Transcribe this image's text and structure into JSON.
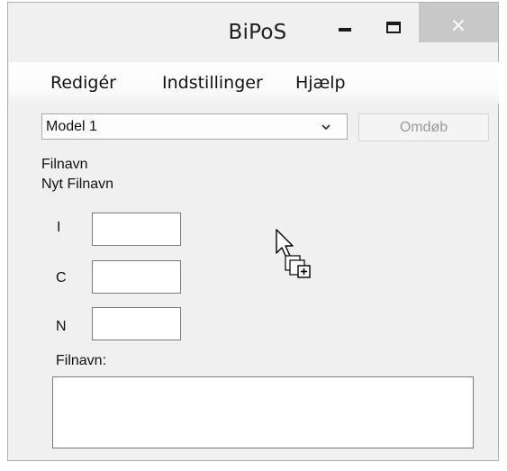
{
  "window": {
    "title": "BiPoS",
    "controls": {
      "minimize": "minimize-icon",
      "maximize": "maximize-icon",
      "close_symbol": "×"
    }
  },
  "menubar": {
    "items": [
      {
        "label": "Redigér"
      },
      {
        "label": "Indstillinger"
      },
      {
        "label": "Hjælp"
      }
    ]
  },
  "model_select": {
    "value": "Model 1",
    "icon": "chevron-down-icon"
  },
  "rename_button": {
    "label": "Omdøb",
    "state": "disabled"
  },
  "labels": {
    "filename": "Filnavn",
    "new_filename": "Nyt Filnavn"
  },
  "fields": [
    {
      "label": "I",
      "value": ""
    },
    {
      "label": "C",
      "value": ""
    },
    {
      "label": "N",
      "value": ""
    }
  ],
  "output": {
    "label": "Filnavn:",
    "value": ""
  },
  "cursor": {
    "icon": "copy-drag-cursor-icon"
  },
  "colors": {
    "window_bg": "#f0f0f0",
    "close_button_bg": "#c8c8c8",
    "disabled_text": "#9a9a9a"
  }
}
